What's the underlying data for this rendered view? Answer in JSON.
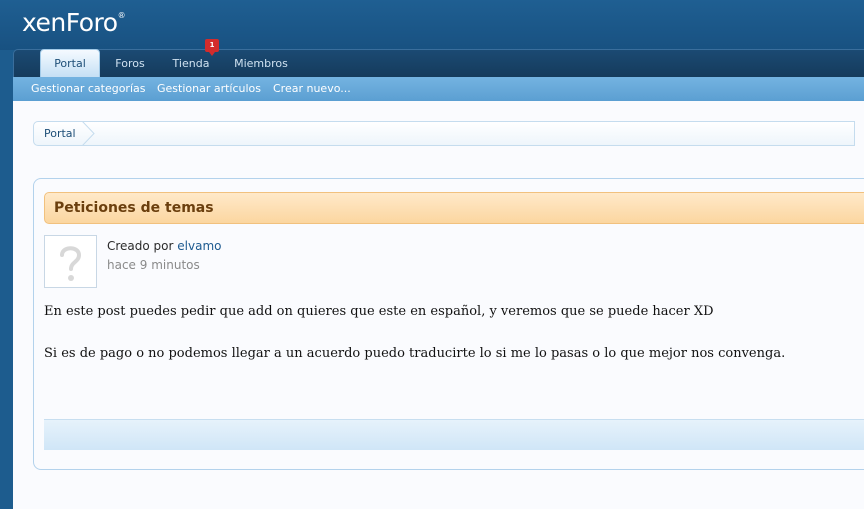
{
  "header": {
    "logo": "xenForo",
    "logo_mark": "®"
  },
  "nav": {
    "tabs": [
      {
        "label": "Portal",
        "active": true
      },
      {
        "label": "Foros"
      },
      {
        "label": "Tienda",
        "badge": "1"
      },
      {
        "label": "Miembros"
      }
    ]
  },
  "subnav": {
    "items": [
      "Gestionar categorías",
      "Gestionar artículos",
      "Crear nuevo..."
    ]
  },
  "breadcrumb": {
    "items": [
      "Portal"
    ]
  },
  "article": {
    "title": "Peticiones de temas",
    "created_by_label": "Creado por",
    "author": "elvamo",
    "time": "hace 9 minutos",
    "paragraphs": [
      "En este post puedes pedir que add on quieres que este en español, y veremos que se puede hacer XD",
      "Si es de pago o no podemos llegar a un acuerdo puedo traducirte lo si me lo pasas o lo que mejor nos convenga."
    ]
  },
  "colors": {
    "header_bg": "#1d5c8e",
    "subnav_bg": "#5b9fd2",
    "title_bg": "#fbd6a0",
    "link": "#1d5a90",
    "badge": "#d32c2c"
  }
}
